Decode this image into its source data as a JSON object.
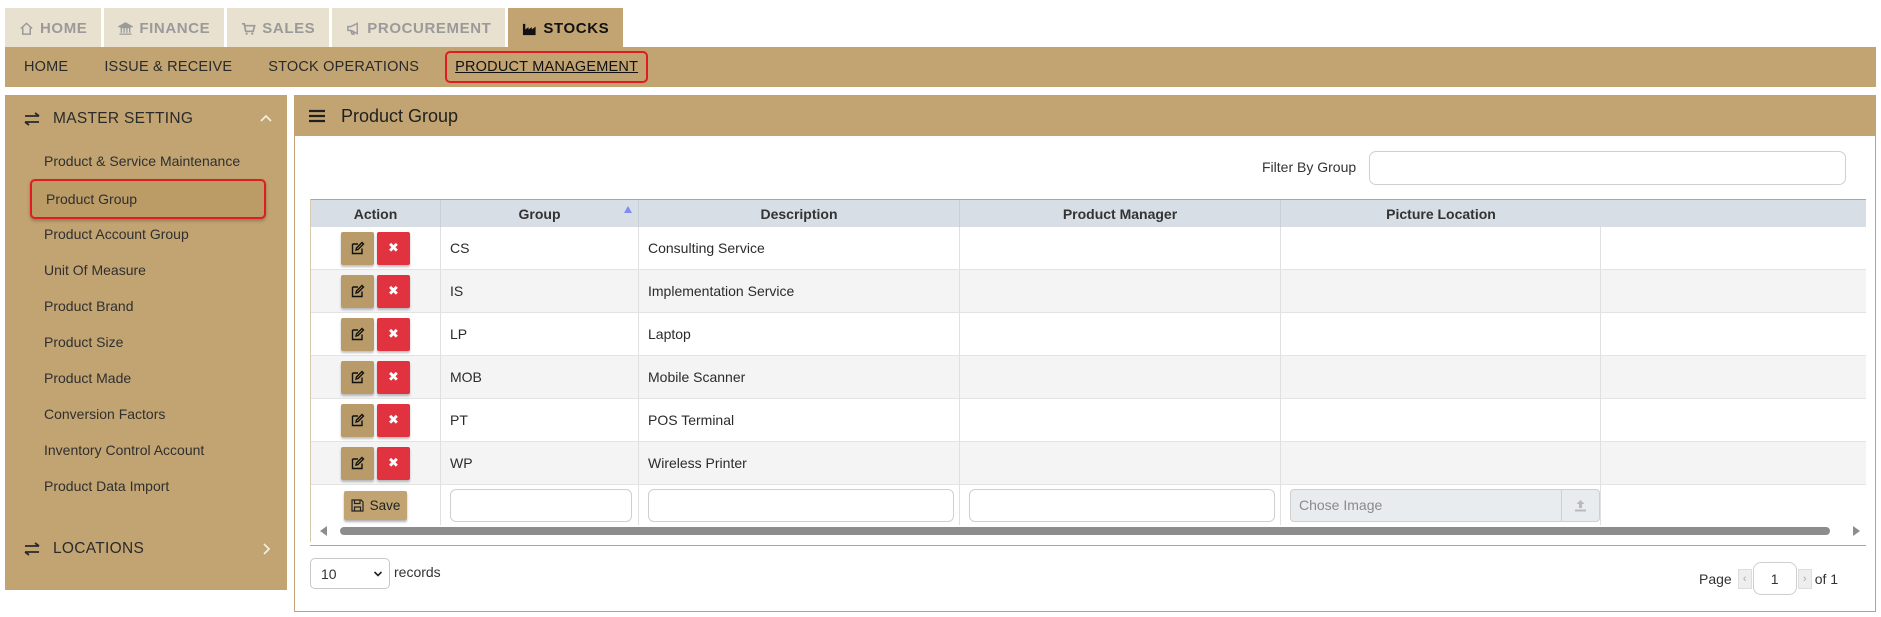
{
  "top_tabs": [
    {
      "label": "HOME",
      "icon": "home-icon",
      "active": false
    },
    {
      "label": "FINANCE",
      "icon": "bank-icon",
      "active": false
    },
    {
      "label": "SALES",
      "icon": "cart-icon",
      "active": false
    },
    {
      "label": "PROCUREMENT",
      "icon": "megaphone-icon",
      "active": false
    },
    {
      "label": "STOCKS",
      "icon": "factory-icon",
      "active": true
    }
  ],
  "sub_nav": [
    "HOME",
    "ISSUE & RECEIVE",
    "STOCK OPERATIONS",
    "PRODUCT MANAGEMENT"
  ],
  "sidebar": {
    "master_setting": "MASTER SETTING",
    "items": [
      "Product & Service Maintenance",
      "Product Group",
      "Product Account Group",
      "Unit Of Measure",
      "Product Brand",
      "Product Size",
      "Product Made",
      "Conversion Factors",
      "Inventory Control Account",
      "Product Data Import"
    ],
    "active_item": "Product Group",
    "locations": "LOCATIONS"
  },
  "panel": {
    "title": "Product Group",
    "filter_label": "Filter By Group"
  },
  "grid": {
    "columns": [
      "Action",
      "Group",
      "Description",
      "Product Manager",
      "Picture Location"
    ],
    "rows": [
      {
        "group": "CS",
        "description": "Consulting Service",
        "manager": "",
        "picture": ""
      },
      {
        "group": "IS",
        "description": "Implementation Service",
        "manager": "",
        "picture": ""
      },
      {
        "group": "LP",
        "description": "Laptop",
        "manager": "",
        "picture": ""
      },
      {
        "group": "MOB",
        "description": "Mobile Scanner",
        "manager": "",
        "picture": ""
      },
      {
        "group": "PT",
        "description": "POS Terminal",
        "manager": "",
        "picture": ""
      },
      {
        "group": "WP",
        "description": "Wireless Printer",
        "manager": "",
        "picture": ""
      }
    ],
    "delete_glyph": "✖",
    "save_label": "Save",
    "file_placeholder": "Chose Image"
  },
  "pagination": {
    "page_size": "10",
    "records_label": "records",
    "page_label": "Page",
    "current_page": "1",
    "of_label": "of 1"
  },
  "colors": {
    "accent": "#c2a472",
    "delete": "#e0333f",
    "highlight_border": "#e01b22",
    "header_bg": "#d7dee6"
  }
}
